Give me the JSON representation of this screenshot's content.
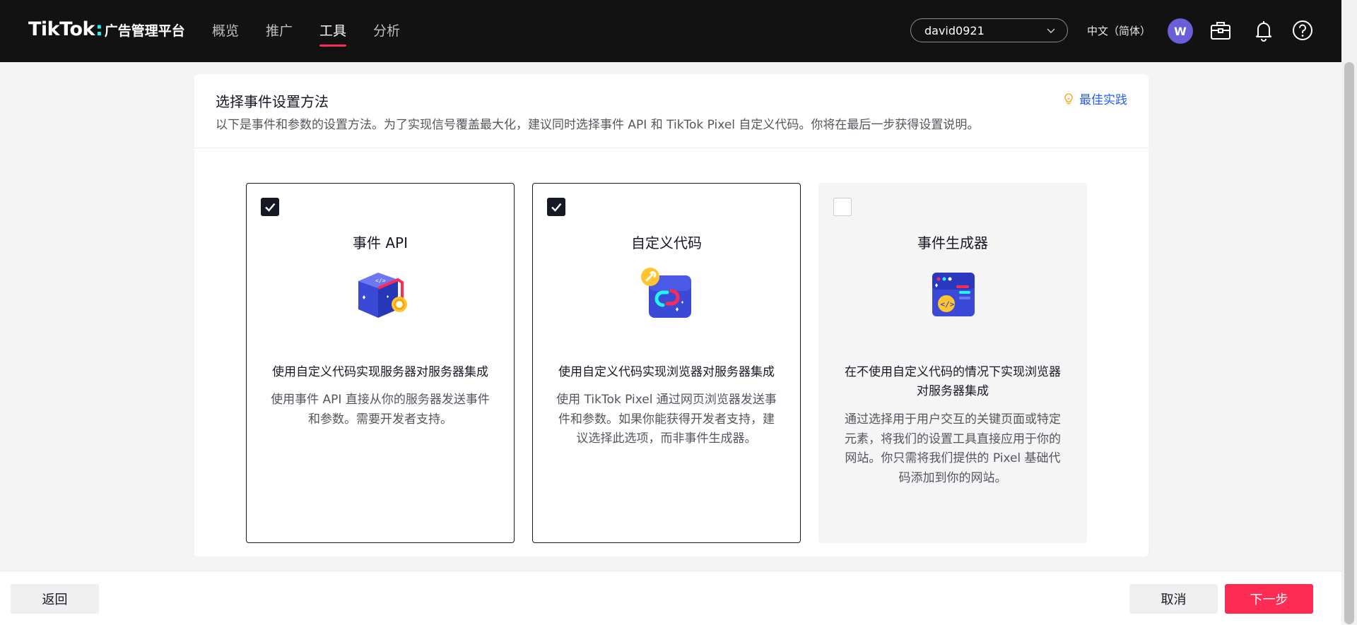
{
  "header": {
    "brand": "TikTok",
    "brand_sub": "广告管理平台",
    "nav": [
      {
        "label": "概览",
        "active": false
      },
      {
        "label": "推广",
        "active": false
      },
      {
        "label": "工具",
        "active": true
      },
      {
        "label": "分析",
        "active": false
      }
    ],
    "account": "david0921",
    "language": "中文（简体）",
    "avatar_initial": "W",
    "icons": [
      "briefcase-icon",
      "bell-icon",
      "help-icon"
    ],
    "accent_color": "#fe2c55"
  },
  "panel": {
    "title": "选择事件设置方法",
    "description": "以下是事件和参数的设置方法。为了实现信号覆盖最大化，建议同时选择事件 API 和 TikTok Pixel 自定义代码。你将在最后一步获得设置说明。",
    "best_practice": "最佳实践",
    "cards": [
      {
        "checked": true,
        "title": "事件 API",
        "icon": "server-cube-icon",
        "subtitle": "使用自定义代码实现服务器对服务器集成",
        "body": "使用事件 API 直接从你的服务器发送事件和参数。需要开发者支持。"
      },
      {
        "checked": true,
        "title": "自定义代码",
        "icon": "code-link-icon",
        "subtitle": "使用自定义代码实现浏览器对服务器集成",
        "body": "使用 TikTok Pixel 通过网页浏览器发送事件和参数。如果你能获得开发者支持，建议选择此选项，而非事件生成器。"
      },
      {
        "checked": false,
        "title": "事件生成器",
        "icon": "event-builder-icon",
        "subtitle": "在不使用自定义代码的情况下实现浏览器对服务器集成",
        "body": "通过选择用于用户交互的关键页面或特定元素，将我们的设置工具直接应用于你的网站。你只需将我们提供的 Pixel 基础代码添加到你的网站。"
      }
    ]
  },
  "footer": {
    "back": "返回",
    "cancel": "取消",
    "next": "下一步"
  }
}
